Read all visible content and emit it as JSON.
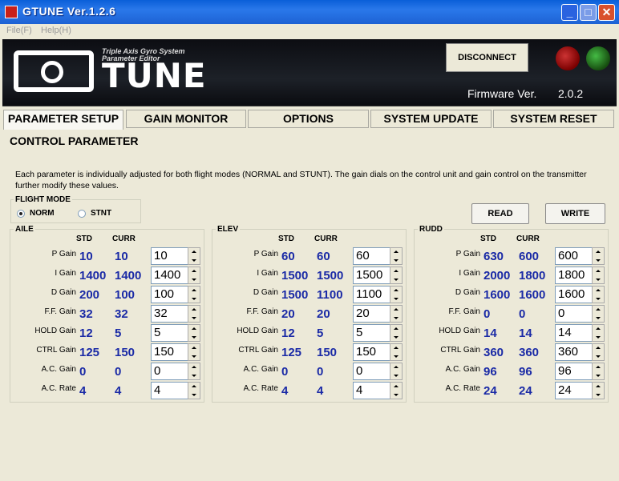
{
  "window": {
    "title": "GTUNE Ver.1.2.6"
  },
  "menu": {
    "file": "File(F)",
    "help": "Help(H)"
  },
  "banner": {
    "logo_text": "TUNE",
    "subtitle_line1": "Triple Axis Gyro System",
    "subtitle_line2": "Parameter Editor",
    "disconnect_label": "DISCONNECT",
    "firmware_label": "Firmware Ver.",
    "firmware_value": "2.0.2"
  },
  "tabs": [
    {
      "label": "PARAMETER SETUP"
    },
    {
      "label": "GAIN MONITOR"
    },
    {
      "label": "OPTIONS"
    },
    {
      "label": "SYSTEM UPDATE"
    },
    {
      "label": "SYSTEM RESET"
    }
  ],
  "page": {
    "title": "CONTROL PARAMETER",
    "description": "Each parameter is individually adjusted for both flight modes (NORMAL and STUNT). The gain dials on the control unit and gain control on the transmitter further modify these values."
  },
  "flight_mode": {
    "legend": "FLIGHT MODE",
    "norm_label": "NORM",
    "stnt_label": "STNT",
    "selected": "NORM"
  },
  "actions": {
    "read_label": "READ",
    "write_label": "WRITE"
  },
  "columns": {
    "std": "STD",
    "curr": "CURR"
  },
  "row_labels": [
    "P Gain",
    "I Gain",
    "D Gain",
    "F.F. Gain",
    "HOLD Gain",
    "CTRL Gain",
    "A.C. Gain",
    "A.C. Rate"
  ],
  "groups": {
    "aile": {
      "legend": "AILE",
      "rows": [
        {
          "std": "10",
          "curr": "10",
          "input": "10"
        },
        {
          "std": "1400",
          "curr": "1400",
          "input": "1400"
        },
        {
          "std": "200",
          "curr": "100",
          "input": "100"
        },
        {
          "std": "32",
          "curr": "32",
          "input": "32"
        },
        {
          "std": "12",
          "curr": "5",
          "input": "5"
        },
        {
          "std": "125",
          "curr": "150",
          "input": "150"
        },
        {
          "std": "0",
          "curr": "0",
          "input": "0"
        },
        {
          "std": "4",
          "curr": "4",
          "input": "4"
        }
      ]
    },
    "elev": {
      "legend": "ELEV",
      "rows": [
        {
          "std": "60",
          "curr": "60",
          "input": "60"
        },
        {
          "std": "1500",
          "curr": "1500",
          "input": "1500"
        },
        {
          "std": "1500",
          "curr": "1100",
          "input": "1100"
        },
        {
          "std": "20",
          "curr": "20",
          "input": "20"
        },
        {
          "std": "12",
          "curr": "5",
          "input": "5"
        },
        {
          "std": "125",
          "curr": "150",
          "input": "150"
        },
        {
          "std": "0",
          "curr": "0",
          "input": "0"
        },
        {
          "std": "4",
          "curr": "4",
          "input": "4"
        }
      ]
    },
    "rudd": {
      "legend": "RUDD",
      "rows": [
        {
          "std": "630",
          "curr": "600",
          "input": "600"
        },
        {
          "std": "2000",
          "curr": "1800",
          "input": "1800"
        },
        {
          "std": "1600",
          "curr": "1600",
          "input": "1600"
        },
        {
          "std": "0",
          "curr": "0",
          "input": "0"
        },
        {
          "std": "14",
          "curr": "14",
          "input": "14"
        },
        {
          "std": "360",
          "curr": "360",
          "input": "360"
        },
        {
          "std": "96",
          "curr": "96",
          "input": "96"
        },
        {
          "std": "24",
          "curr": "24",
          "input": "24"
        }
      ]
    }
  }
}
